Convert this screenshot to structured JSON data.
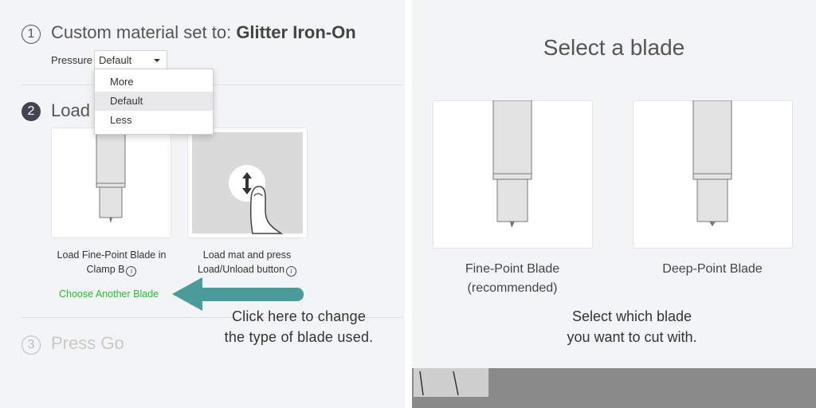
{
  "step1": {
    "number": "1",
    "title_prefix": "Custom material set to: ",
    "title_material": "Glitter Iron-On",
    "pressure_label": "Pressure",
    "pressure_value": "Default",
    "dropdown_options": [
      "More",
      "Default",
      "Less"
    ],
    "dropdown_selected": "Default"
  },
  "step2": {
    "number": "2",
    "title": "Load t",
    "card1_caption_line1": "Load Fine-Point Blade in",
    "card1_caption_line2": "Clamp B",
    "card2_caption_line1": "Load mat and press",
    "card2_caption_line2": "Load/Unload button",
    "info_symbol": "i",
    "choose_link": "Choose Another Blade"
  },
  "step3": {
    "number": "3",
    "title": "Press Go"
  },
  "left_callout": {
    "line1": "Click here to change",
    "line2": "the type of blade used."
  },
  "right": {
    "title": "Select a blade",
    "blade1_name": "Fine-Point Blade",
    "blade1_note": "(recommended)",
    "blade2_name": "Deep-Point Blade",
    "callout_line1": "Select which blade",
    "callout_line2": "you want to cut with."
  },
  "colors": {
    "panel_bg": "#f3f4f6",
    "link_green": "#24c02e",
    "arrow_teal": "#4a9b9a",
    "step_filled": "#3f4650"
  },
  "icons": {
    "mat_button": "up-down-arrow-icon",
    "finger": "finger-press-icon",
    "blade": "blade-housing-icon"
  }
}
